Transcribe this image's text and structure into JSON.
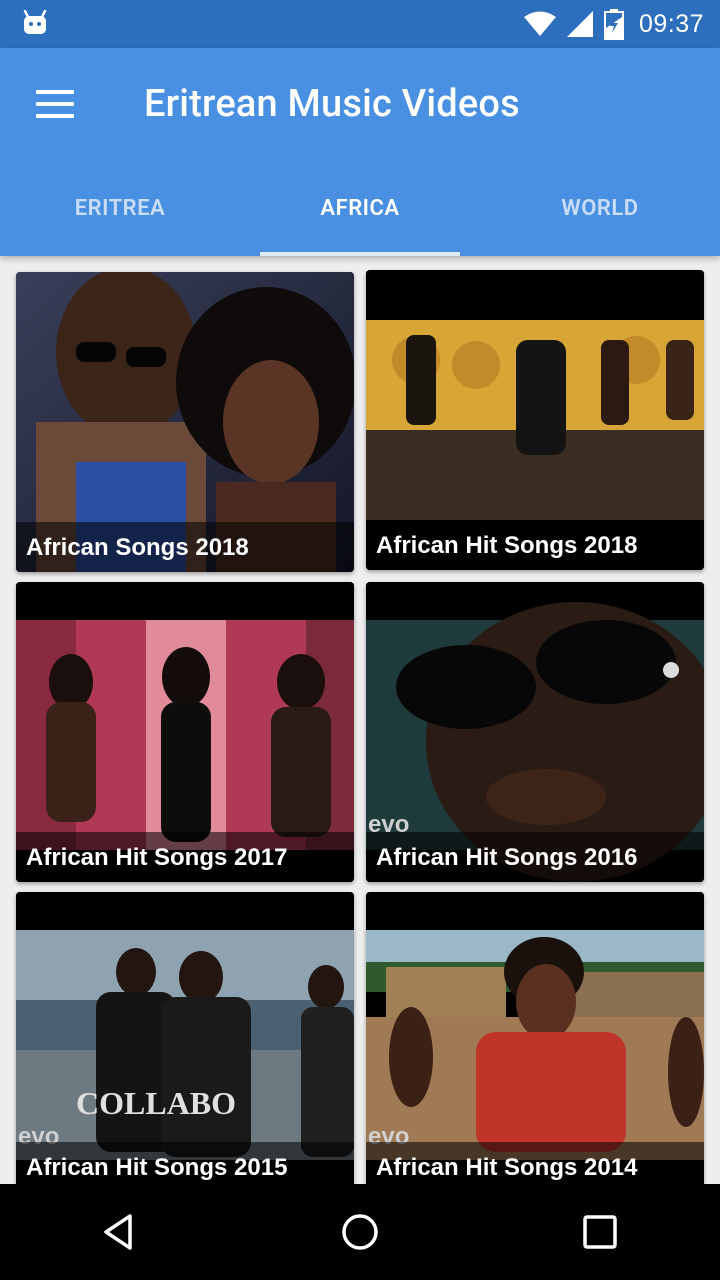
{
  "status_bar": {
    "time": "09:37"
  },
  "app_bar": {
    "title": "Eritrean Music Videos"
  },
  "tabs": [
    {
      "label": "ERITREA",
      "active": false
    },
    {
      "label": "AFRICA",
      "active": true
    },
    {
      "label": "WORLD",
      "active": false
    }
  ],
  "videos": [
    {
      "title": "African Songs 2018"
    },
    {
      "title": "African Hit Songs 2018"
    },
    {
      "title": "African Hit Songs 2017"
    },
    {
      "title": "African Hit Songs 2016"
    },
    {
      "title": "African Hit Songs 2015"
    },
    {
      "title": "African Hit Songs 2014"
    }
  ],
  "thumb_text": {
    "collabo": "COLLABO",
    "evo": "evo"
  },
  "colors": {
    "status_bar": "#2e6fbd",
    "app_bar": "#4a90e2",
    "background": "#eeeeee"
  },
  "icons": [
    "android-icon",
    "wifi-icon",
    "signal-icon",
    "battery-icon",
    "menu-icon",
    "back-icon",
    "home-icon",
    "recents-icon"
  ]
}
